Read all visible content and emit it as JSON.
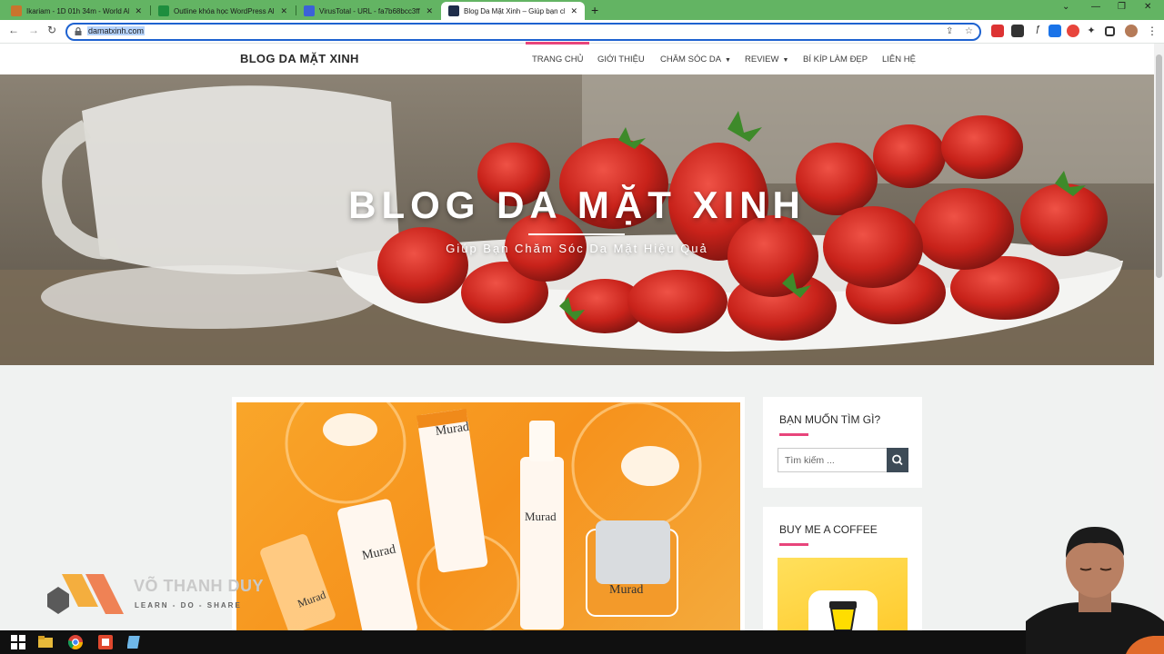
{
  "browser": {
    "tabs": [
      {
        "title": "Ikariam - 1D 01h 34m - World Al",
        "active": false
      },
      {
        "title": "Outline khóa học WordPress All",
        "active": false
      },
      {
        "title": "VirusTotal - URL - fa7b68bcc3ff1",
        "active": false
      },
      {
        "title": "Blog Da Mặt Xinh – Giúp bạn chă",
        "active": true
      }
    ],
    "new_tab_glyph": "+",
    "url": "damatxinh.com"
  },
  "site": {
    "brand": "BLOG DA MẶT XINH",
    "menu": [
      {
        "label": "TRANG CHỦ",
        "dropdown": false
      },
      {
        "label": "GIỚI THIỆU",
        "dropdown": false
      },
      {
        "label": "CHĂM SÓC DA",
        "dropdown": true
      },
      {
        "label": "REVIEW",
        "dropdown": true
      },
      {
        "label": "BÍ KÍP LÀM ĐẸP",
        "dropdown": false
      },
      {
        "label": "LIÊN HỆ",
        "dropdown": false
      }
    ],
    "accent_color": "#e8457b"
  },
  "hero": {
    "title": "BLOG DA MẶT XINH",
    "subtitle": "Giúp Bạn Chăm Sóc Da Mặt Hiệu Quả"
  },
  "post": {
    "brand_on_products": "Murad"
  },
  "sidebar": {
    "search_widget": {
      "title": "BẠN MUỐN TÌM GÌ?",
      "placeholder": "Tìm kiếm ..."
    },
    "coffee_widget": {
      "title": "BUY ME A COFFEE"
    }
  },
  "watermark": {
    "name": "VÕ THANH DUY",
    "tagline": "LEARN - DO - SHARE"
  }
}
